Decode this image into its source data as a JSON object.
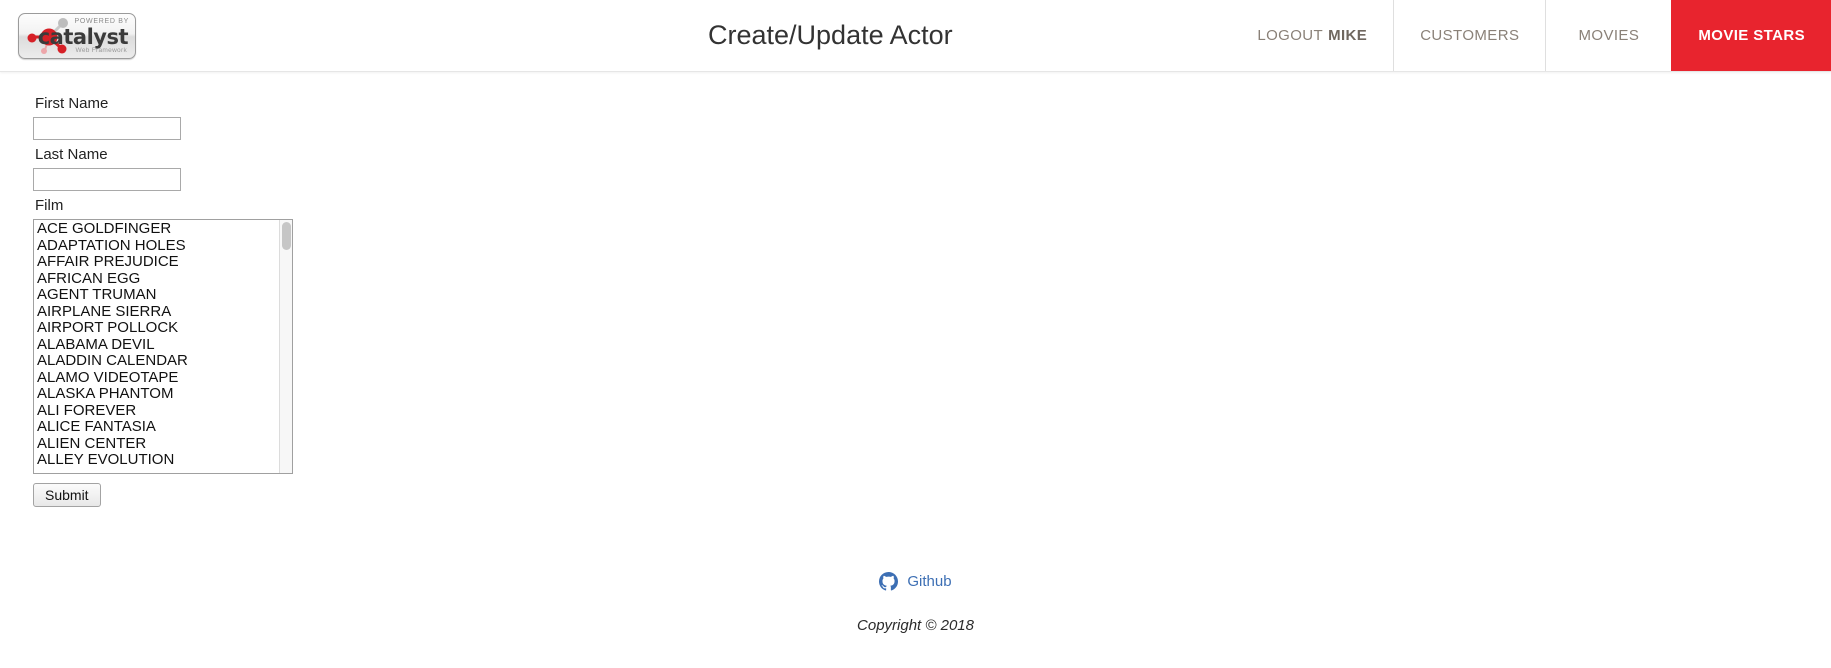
{
  "brand": {
    "powered_by": "POWERED BY",
    "name": "catalyst",
    "tagline": "Web Framework",
    "logo_icon": "catalyst-molecule-logo"
  },
  "header": {
    "title": "Create/Update Actor",
    "accent_color": "#e8242e",
    "nav": [
      {
        "label": "LOGOUT",
        "user": "MIKE",
        "name": "logout",
        "active": false
      },
      {
        "label": "CUSTOMERS",
        "name": "customers",
        "active": false
      },
      {
        "label": "MOVIES",
        "name": "movies",
        "active": false
      },
      {
        "label": "MOVIE STARS",
        "name": "movie-stars",
        "active": true
      }
    ]
  },
  "form": {
    "first_name": {
      "label": "First Name",
      "value": "",
      "placeholder": ""
    },
    "last_name": {
      "label": "Last Name",
      "value": "",
      "placeholder": ""
    },
    "film": {
      "label": "Film",
      "options": [
        "ACE GOLDFINGER",
        "ADAPTATION HOLES",
        "AFFAIR PREJUDICE",
        "AFRICAN EGG",
        "AGENT TRUMAN",
        "AIRPLANE SIERRA",
        "AIRPORT POLLOCK",
        "ALABAMA DEVIL",
        "ALADDIN CALENDAR",
        "ALAMO VIDEOTAPE",
        "ALASKA PHANTOM",
        "ALI FOREVER",
        "ALICE FANTASIA",
        "ALIEN CENTER",
        "ALLEY EVOLUTION"
      ],
      "selected": []
    },
    "submit_label": "Submit"
  },
  "footer": {
    "github_label": "Github",
    "github_icon": "github-icon",
    "github_color": "#3d6fb4",
    "copyright": "Copyright © 2018"
  }
}
